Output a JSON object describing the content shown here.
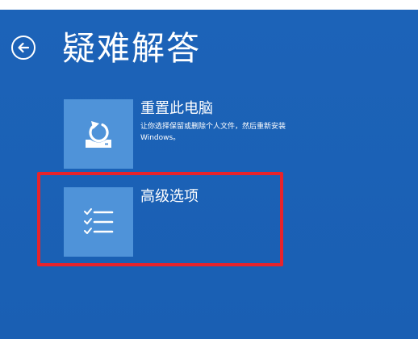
{
  "header": {
    "title": "疑难解答",
    "back_icon": "back-arrow-circle-icon"
  },
  "options": [
    {
      "title": "重置此电脑",
      "description": "让你选择保留或删除个人文件，然后重新安装 Windows。",
      "icon": "reset-pc-icon"
    },
    {
      "title": "高级选项",
      "description": "",
      "icon": "checklist-icon"
    }
  ],
  "colors": {
    "background": "#1a5fb4",
    "tile": "#4f93d9",
    "highlight": "#e8232b",
    "text": "#ffffff"
  }
}
